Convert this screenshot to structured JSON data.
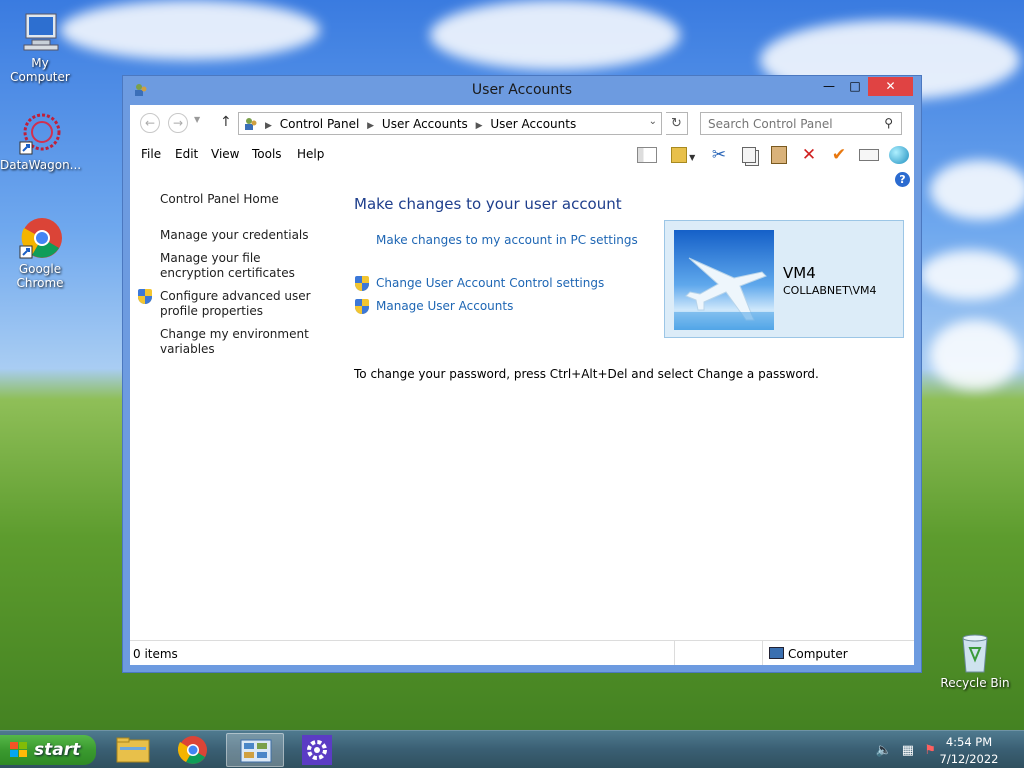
{
  "desktop": {
    "icons": [
      {
        "label": "My Computer"
      },
      {
        "label": "DataWagon..."
      },
      {
        "label": "Google Chrome"
      },
      {
        "label": "Recycle Bin"
      }
    ]
  },
  "window": {
    "title": "User Accounts",
    "breadcrumbs": [
      "Control Panel",
      "User Accounts",
      "User Accounts"
    ],
    "search_placeholder": "Search Control Panel",
    "menus": [
      "File",
      "Edit",
      "View",
      "Tools",
      "Help"
    ],
    "left_pane": {
      "home": "Control Panel Home",
      "items": [
        "Manage your credentials",
        "Manage your file encryption certificates",
        "Configure advanced user profile properties",
        "Change my environment variables"
      ]
    },
    "main": {
      "title": "Make changes to your user account",
      "link_pc_settings": "Make changes to my account in PC settings",
      "link_uac": "Change User Account Control settings",
      "link_manage": "Manage User Accounts",
      "password_note": "To change your password, press Ctrl+Alt+Del and select Change a password."
    },
    "user": {
      "name": "VM4",
      "domain": "COLLABNET\\VM4"
    },
    "status": {
      "items": "0 items",
      "location": "Computer"
    }
  },
  "taskbar": {
    "start_label": "start",
    "time": "4:54 PM",
    "date": "7/12/2022"
  },
  "colors": {
    "link": "#1e66b4",
    "heading": "#1e3e8c",
    "close_button": "#e04343",
    "window_frame": "#6d9be0"
  }
}
